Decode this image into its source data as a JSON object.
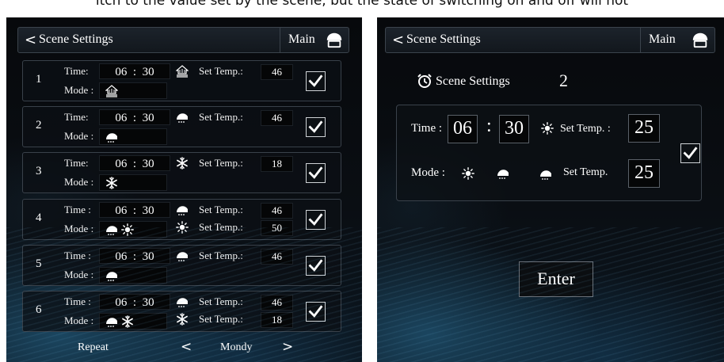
{
  "caption": "itch to the value set by the scene, but the state of switching on and off will not",
  "left": {
    "header": {
      "back": "<",
      "title": "Scene Settings",
      "main": "Main"
    },
    "labels": {
      "time": "Time:",
      "time_alt": "Time :",
      "mode": "Mode :",
      "set_temp": "Set Temp.:"
    },
    "rows": [
      {
        "num": "1",
        "time": "06  :  30",
        "time_label": "Time:",
        "setpoints": [
          {
            "icon": "floor-heat",
            "temp": "46"
          }
        ],
        "modes": [
          "floor-heat"
        ],
        "checked": true
      },
      {
        "num": "2",
        "time": "06  :  30",
        "time_label": "Time:",
        "setpoints": [
          {
            "icon": "water-heat",
            "temp": "46"
          }
        ],
        "modes": [
          "water-heat"
        ],
        "checked": true
      },
      {
        "num": "3",
        "time": "06  :  30",
        "time_label": "Time:",
        "setpoints": [
          {
            "icon": "cooling",
            "temp": "18"
          }
        ],
        "modes": [
          "cooling"
        ],
        "checked": true
      },
      {
        "num": "4",
        "time": "06  :  30",
        "time_label": "Time :",
        "setpoints": [
          {
            "icon": "water-heat",
            "temp": "46"
          },
          {
            "icon": "heating",
            "temp": "50"
          }
        ],
        "modes": [
          "water-heat",
          "heating"
        ],
        "checked": true
      },
      {
        "num": "5",
        "time": "06  :  30",
        "time_label": "Time :",
        "setpoints": [
          {
            "icon": "water-heat",
            "temp": "46"
          }
        ],
        "modes": [
          "water-heat"
        ],
        "checked": true
      },
      {
        "num": "6",
        "time": "06  :  30",
        "time_label": "Time :",
        "setpoints": [
          {
            "icon": "water-heat",
            "temp": "46"
          },
          {
            "icon": "cooling",
            "temp": "18"
          }
        ],
        "modes": [
          "water-heat",
          "cooling"
        ],
        "checked": true
      }
    ],
    "footer": {
      "repeat": "Repeat",
      "prev": "<",
      "day": "Mondy",
      "next": ">"
    }
  },
  "right": {
    "header": {
      "back": "<",
      "title": "Scene Settings",
      "main": "Main"
    },
    "scene_label": "Scene Settings",
    "scene_number": "2",
    "time_label": "Time :",
    "hour": "06",
    "colon": ":",
    "minute": "30",
    "set_temp_1_label": "Set Temp. :",
    "set_temp_1": "25",
    "mode_label": "Mode :",
    "set_temp_2_label": "Set Temp.",
    "set_temp_2": "25",
    "checked": true,
    "enter": "Enter"
  },
  "colors": {
    "accent": "#2a7fb0",
    "text": "#ffffff",
    "border": "#39414a"
  }
}
